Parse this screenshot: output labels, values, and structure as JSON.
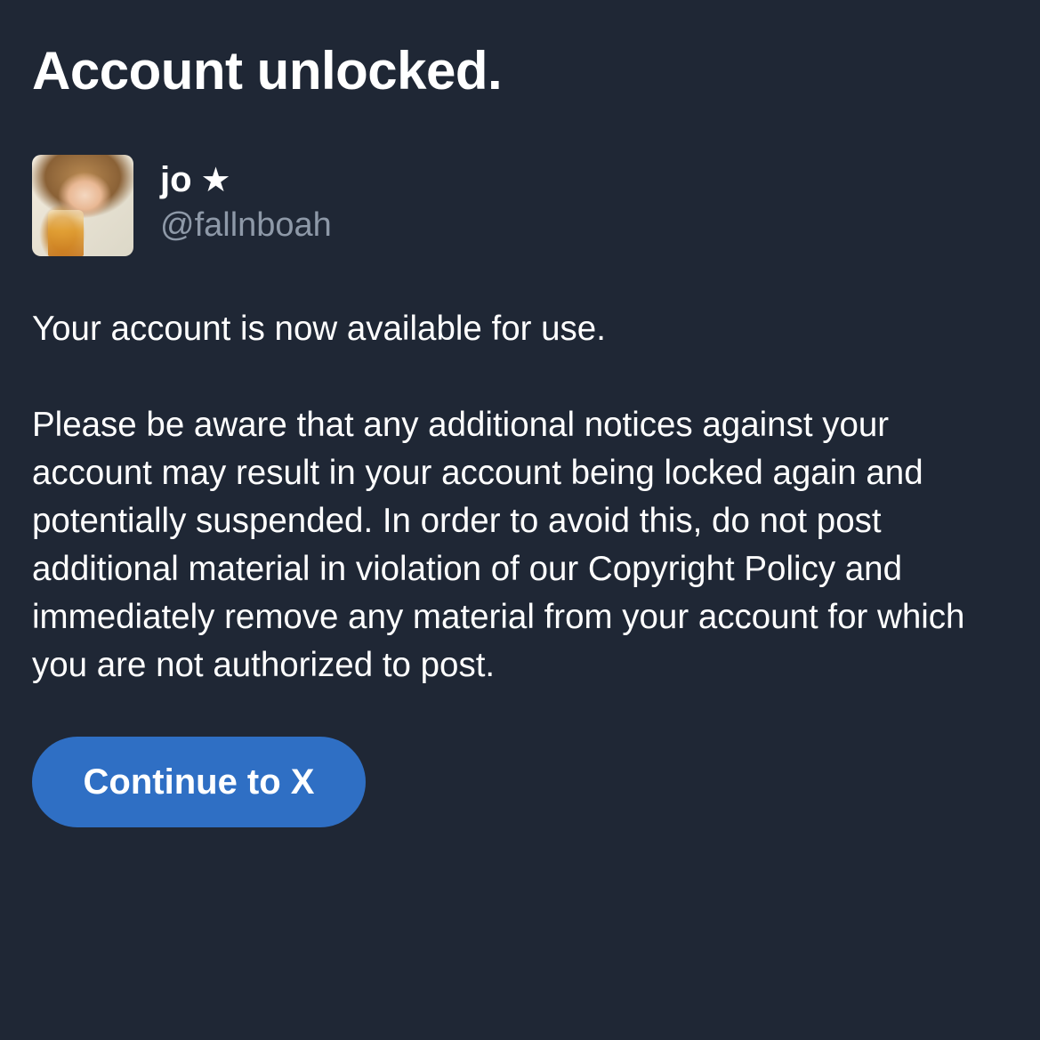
{
  "title": "Account unlocked.",
  "user": {
    "display_name": "jo",
    "name_badge": "★",
    "handle": "@fallnboah",
    "avatar_icon": "profile-photo"
  },
  "messages": {
    "status": "Your account is now available for use.",
    "notice": "Please be aware that any additional notices against your account may result in your account being locked again and potentially suspended. In order to avoid this, do not post additional material in violation of our Copyright Policy and immediately remove any material from your account for which you are not authorized to post."
  },
  "actions": {
    "continue_label": "Continue to X"
  },
  "colors": {
    "background": "#1f2735",
    "text": "#ffffff",
    "secondary_text": "#8e99a8",
    "button": "#2f6fc4"
  }
}
